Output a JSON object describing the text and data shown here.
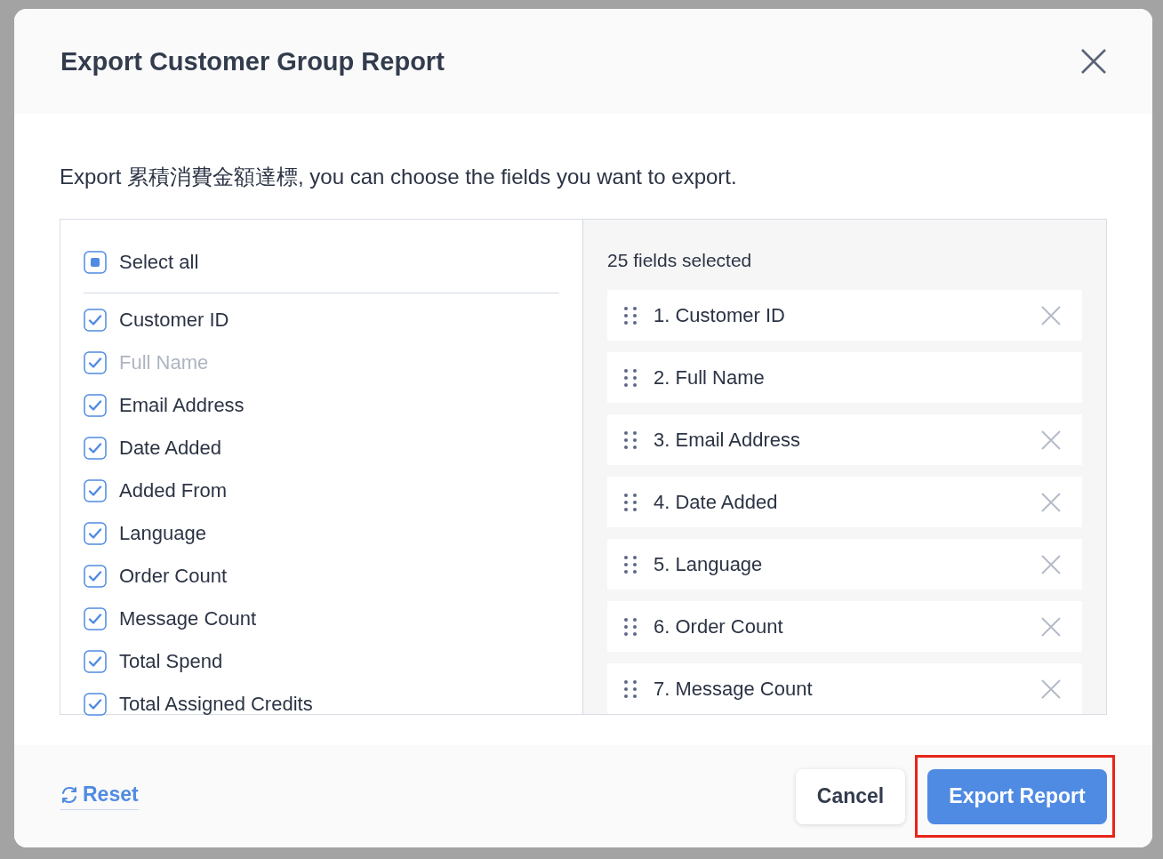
{
  "dialog": {
    "title": "Export Customer Group Report",
    "description": "Export 累積消費金額達標, you can choose the fields you want to export."
  },
  "select_all": {
    "label": "Select all",
    "indeterminate": true
  },
  "fields": [
    {
      "label": "Customer ID",
      "checked": true,
      "disabled": false
    },
    {
      "label": "Full Name",
      "checked": true,
      "disabled": true
    },
    {
      "label": "Email Address",
      "checked": true,
      "disabled": false
    },
    {
      "label": "Date Added",
      "checked": true,
      "disabled": false
    },
    {
      "label": "Added From",
      "checked": true,
      "disabled": false
    },
    {
      "label": "Language",
      "checked": true,
      "disabled": false
    },
    {
      "label": "Order Count",
      "checked": true,
      "disabled": false
    },
    {
      "label": "Message Count",
      "checked": true,
      "disabled": false
    },
    {
      "label": "Total Spend",
      "checked": true,
      "disabled": false
    },
    {
      "label": "Total Assigned Credits",
      "checked": true,
      "disabled": false
    }
  ],
  "selected_count": "25 fields selected",
  "selected_fields": [
    {
      "label": "1. Customer ID",
      "removable": true
    },
    {
      "label": "2. Full Name",
      "removable": false
    },
    {
      "label": "3. Email Address",
      "removable": true
    },
    {
      "label": "4. Date Added",
      "removable": true
    },
    {
      "label": "5. Language",
      "removable": true
    },
    {
      "label": "6. Order Count",
      "removable": true
    },
    {
      "label": "7. Message Count",
      "removable": true
    }
  ],
  "footer": {
    "reset": "Reset",
    "cancel": "Cancel",
    "export": "Export Report",
    "export_highlighted": true
  }
}
